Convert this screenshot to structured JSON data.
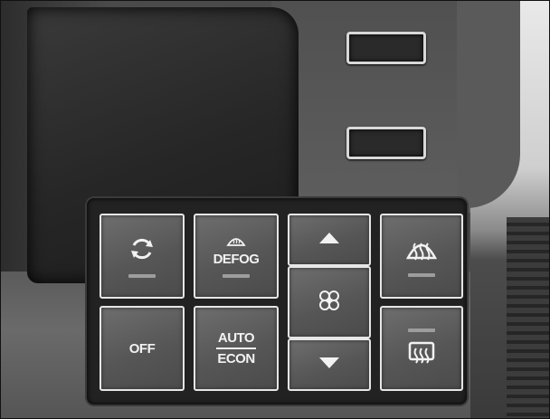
{
  "controls": {
    "recirculate": {
      "icon": "recirculate-icon"
    },
    "defog": {
      "label": "DEFOG",
      "icon": "windshield-icon"
    },
    "off": {
      "label": "OFF"
    },
    "auto_econ": {
      "line1": "AUTO",
      "line2": "ECON"
    },
    "fan_up": {
      "icon": "triangle-up-icon"
    },
    "fan": {
      "icon": "fan-icon"
    },
    "fan_down": {
      "icon": "triangle-down-icon"
    },
    "front_defrost": {
      "icon": "front-defrost-icon"
    },
    "rear_defrost": {
      "icon": "rear-defrost-icon"
    }
  },
  "colors": {
    "button_face": "#5a5a5a",
    "button_border": "#e6e6e6",
    "label": "#f2f2f2",
    "bezel": "#222222"
  }
}
